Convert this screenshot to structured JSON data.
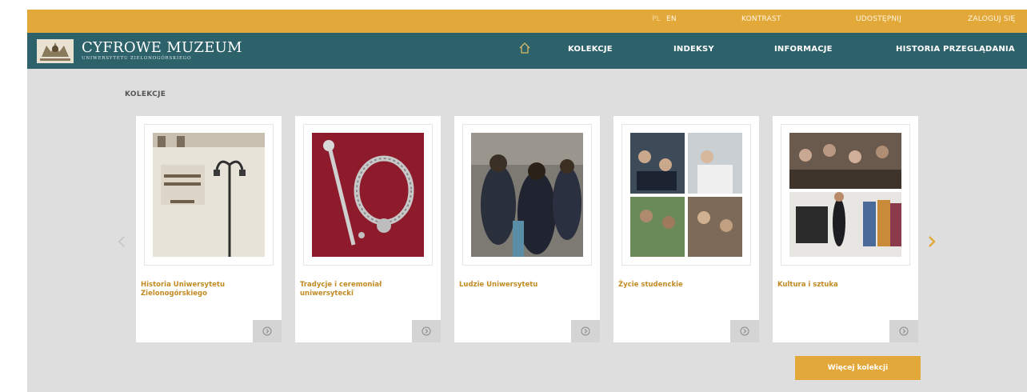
{
  "topbar": {
    "lang_pl": "PL",
    "lang_en": "EN",
    "contrast": "KONTRAST",
    "share": "UDOSTĘPNIJ",
    "login": "ZALOGUJ SIĘ"
  },
  "logo": {
    "title": "CYFROWE MUZEUM",
    "subtitle": "UNIWERSYTETU ZIELONOGÓRSKIEGO"
  },
  "nav": {
    "home_icon": "home-icon",
    "items": [
      "KOLEKCJE",
      "INDEKSY",
      "INFORMACJE",
      "HISTORIA PRZEGLĄDANIA"
    ]
  },
  "main": {
    "section_title": "KOLEKCJE",
    "cards": [
      {
        "title": "Historia Uniwersytetu Zielonogórskiego"
      },
      {
        "title": "Tradycje i ceremoniał uniwersytecki"
      },
      {
        "title": "Ludzie Uniwersytetu"
      },
      {
        "title": "Życie studenckie"
      },
      {
        "title": "Kultura i sztuka"
      }
    ],
    "more_button": "Więcej kolekcji"
  },
  "colors": {
    "topbar": "#e3a83a",
    "navbar": "#2e626b",
    "content_bg": "#dedede",
    "card_title": "#c28a22",
    "button": "#e3a83a"
  }
}
